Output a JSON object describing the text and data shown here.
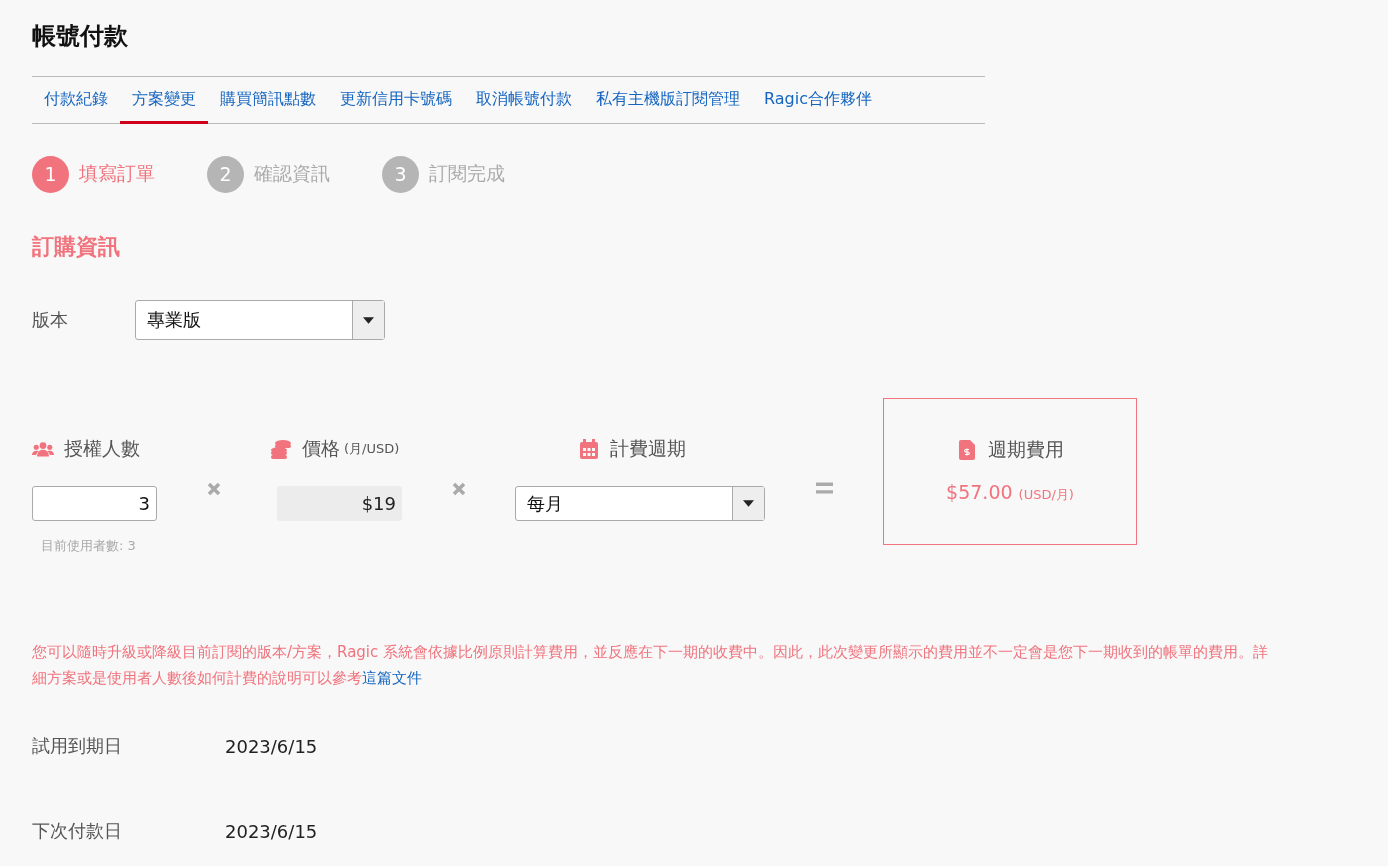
{
  "title": "帳號付款",
  "tabs": [
    {
      "label": "付款紀錄",
      "selected": false
    },
    {
      "label": "方案變更",
      "selected": true
    },
    {
      "label": "購買簡訊點數",
      "selected": false
    },
    {
      "label": "更新信用卡號碼",
      "selected": false
    },
    {
      "label": "取消帳號付款",
      "selected": false
    },
    {
      "label": "私有主機版訂閱管理",
      "selected": false
    },
    {
      "label": "Ragic合作夥伴",
      "selected": false
    }
  ],
  "steps": [
    {
      "number": "1",
      "label": "填寫訂單",
      "selected": true
    },
    {
      "number": "2",
      "label": "確認資訊",
      "selected": false
    },
    {
      "number": "3",
      "label": "訂閱完成",
      "selected": false
    }
  ],
  "section_title": "訂購資訊",
  "edition": {
    "label": "版本",
    "value": "專業版"
  },
  "users": {
    "label": "授權人數",
    "value": "3",
    "hint": "目前使用者數: 3"
  },
  "price": {
    "label": "價格",
    "unit": "(月/USD)",
    "value": "$19"
  },
  "cycle": {
    "label": "計費週期",
    "value": "每月"
  },
  "total": {
    "label": "週期費用",
    "amount": "$57.00",
    "unit": "(USD/月)"
  },
  "notice": {
    "text": "您可以隨時升級或降級目前訂閱的版本/方案，Ragic 系統會依據比例原則計算費用，並反應在下一期的收費中。因此，此次變更所顯示的費用並不一定會是您下一期收到的帳單的費用。詳細方案或是使用者人數後如何計費的說明可以參考",
    "link": "這篇文件"
  },
  "dates": [
    {
      "label": "試用到期日",
      "value": "2023/6/15"
    },
    {
      "label": "下次付款日",
      "value": "2023/6/15"
    }
  ]
}
